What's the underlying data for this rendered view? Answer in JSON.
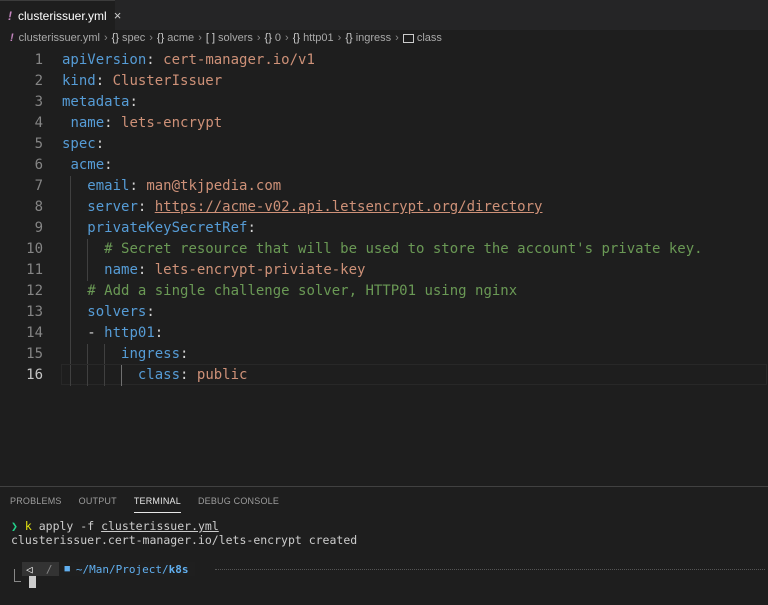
{
  "tab": {
    "icon": "yaml-exclamation-icon",
    "label": "clusterissuer.yml",
    "close": "×"
  },
  "breadcrumb": [
    {
      "icon": "!",
      "label": "clusterissuer.yml"
    },
    {
      "icon": "{}",
      "label": "spec"
    },
    {
      "icon": "{}",
      "label": "acme"
    },
    {
      "icon": "[ ]",
      "label": "solvers"
    },
    {
      "icon": "{}",
      "label": "0"
    },
    {
      "icon": "{}",
      "label": "http01"
    },
    {
      "icon": "{}",
      "label": "ingress"
    },
    {
      "icon": "class-icon",
      "label": "class"
    }
  ],
  "editor": {
    "active_line": 16,
    "lines": [
      {
        "n": "1",
        "key": "apiVersion",
        "val": "cert-manager.io/v1"
      },
      {
        "n": "2",
        "key": "kind",
        "val": "ClusterIssuer"
      },
      {
        "n": "3",
        "key": "metadata",
        "val": ""
      },
      {
        "n": "4",
        "key": "name",
        "val": "lets-encrypt"
      },
      {
        "n": "5",
        "key": "spec",
        "val": ""
      },
      {
        "n": "6",
        "key": "acme",
        "val": ""
      },
      {
        "n": "7",
        "key": "email",
        "val": "man@tkjpedia.com"
      },
      {
        "n": "8",
        "key": "server",
        "val": "https://acme-v02.api.letsencrypt.org/directory"
      },
      {
        "n": "9",
        "key": "privateKeySecretRef",
        "val": ""
      },
      {
        "n": "10",
        "comment": "# Secret resource that will be used to store the account's private key."
      },
      {
        "n": "11",
        "key": "name",
        "val": "lets-encrypt-priviate-key"
      },
      {
        "n": "12",
        "comment": "# Add a single challenge solver, HTTP01 using nginx"
      },
      {
        "n": "13",
        "key": "solvers",
        "val": ""
      },
      {
        "n": "14",
        "dash": "-",
        "key": "http01",
        "val": ""
      },
      {
        "n": "15",
        "key": "ingress",
        "val": ""
      },
      {
        "n": "16",
        "key": "class",
        "val": "public"
      }
    ]
  },
  "panel": {
    "tabs": [
      "PROBLEMS",
      "OUTPUT",
      "TERMINAL",
      "DEBUG CONSOLE"
    ],
    "active_tab": "TERMINAL",
    "terminal": {
      "prompt_symbol": "❯",
      "cmd_k": "k",
      "cmd_rest": " apply -f ",
      "cmd_file": "clusterissuer.yml",
      "output": "clusterissuer.cert-manager.io/lets-encrypt created",
      "pl_os_icon": "◁",
      "pl_sep": "/",
      "pl_folder_icon": "folder-icon",
      "pl_path_prefix": "~/Man/Project/",
      "pl_path_last": "k8s"
    }
  },
  "colors": {
    "keyword": "#569cd6",
    "string": "#ce9178",
    "comment": "#6a9955",
    "background": "#1e1e1e"
  }
}
